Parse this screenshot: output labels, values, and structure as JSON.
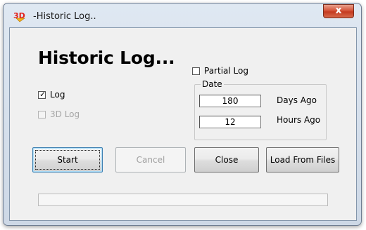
{
  "window": {
    "title": "-Historic Log..",
    "icon": "3d-app-icon",
    "close_glyph": "x"
  },
  "heading": "Historic Log...",
  "checkboxes": {
    "log": {
      "label": "Log",
      "checked": true,
      "enabled": true
    },
    "log3d": {
      "label": "3D Log",
      "checked": false,
      "enabled": false
    },
    "partial": {
      "label": "Partial Log",
      "checked": false,
      "enabled": true
    }
  },
  "date_group": {
    "legend": "Date",
    "days": {
      "value": "180",
      "label": "Days Ago"
    },
    "hours": {
      "value": "12",
      "label": "Hours Ago"
    }
  },
  "buttons": {
    "start": "Start",
    "cancel": "Cancel",
    "close": "Close",
    "load": "Load From Files"
  },
  "progress": {
    "value": 0
  },
  "colors": {
    "title_close": "#c43b20",
    "client_bg": "#f0f0f0",
    "default_button_border": "#3c7fb1"
  }
}
